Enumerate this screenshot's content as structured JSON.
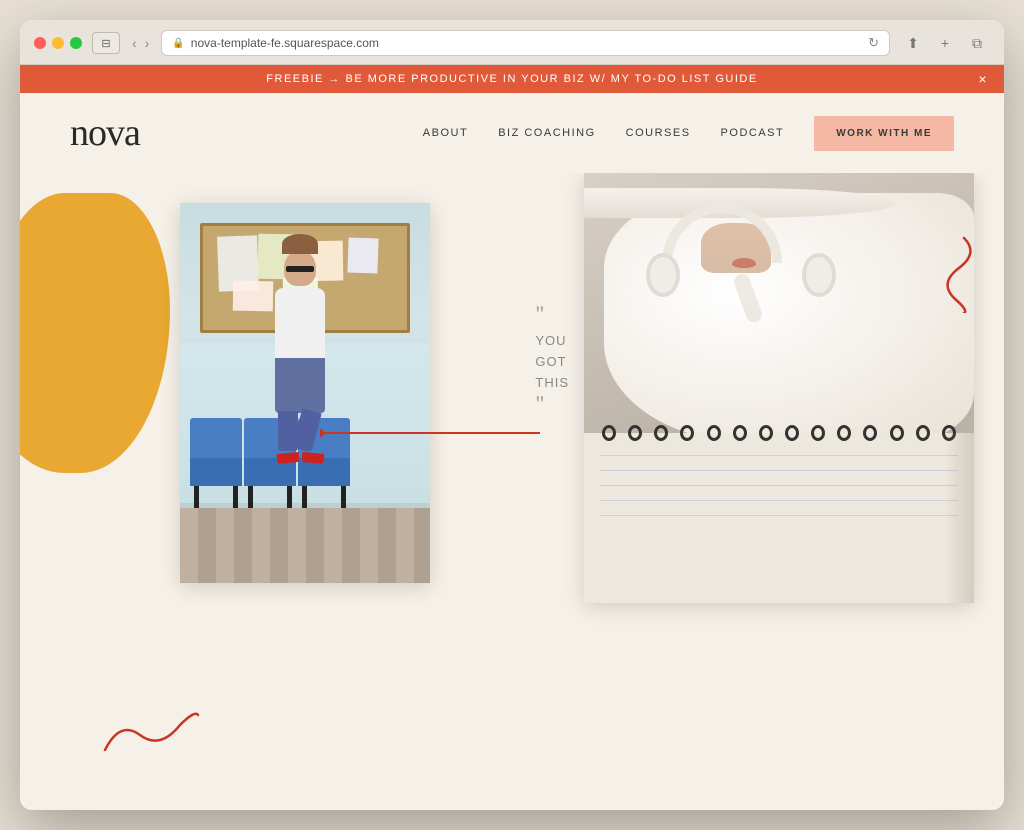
{
  "browser": {
    "url": "nova-template-fe.squarespace.com",
    "refresh_icon": "↻"
  },
  "banner": {
    "text": "FREEBIE → BE MORE PRODUCTIVE IN YOUR BIZ W/ MY TO-DO LIST GUIDE",
    "close_label": "×"
  },
  "nav": {
    "logo": "nova",
    "links": [
      {
        "label": "ABOUT",
        "id": "about"
      },
      {
        "label": "BIZ COACHING",
        "id": "biz-coaching"
      },
      {
        "label": "COURSES",
        "id": "courses"
      },
      {
        "label": "PODCAST",
        "id": "podcast"
      }
    ],
    "cta_label": "WORK WITH ME"
  },
  "quote": {
    "open_mark": "\"",
    "line1": "YOU",
    "line2": "GOT",
    "line3": "THIS",
    "close_mark": "\""
  },
  "colors": {
    "banner_bg": "#e05a3a",
    "nav_cta_bg": "#f4b8a4",
    "blob_yellow": "#e8a832",
    "accent_red": "#cc3322"
  }
}
